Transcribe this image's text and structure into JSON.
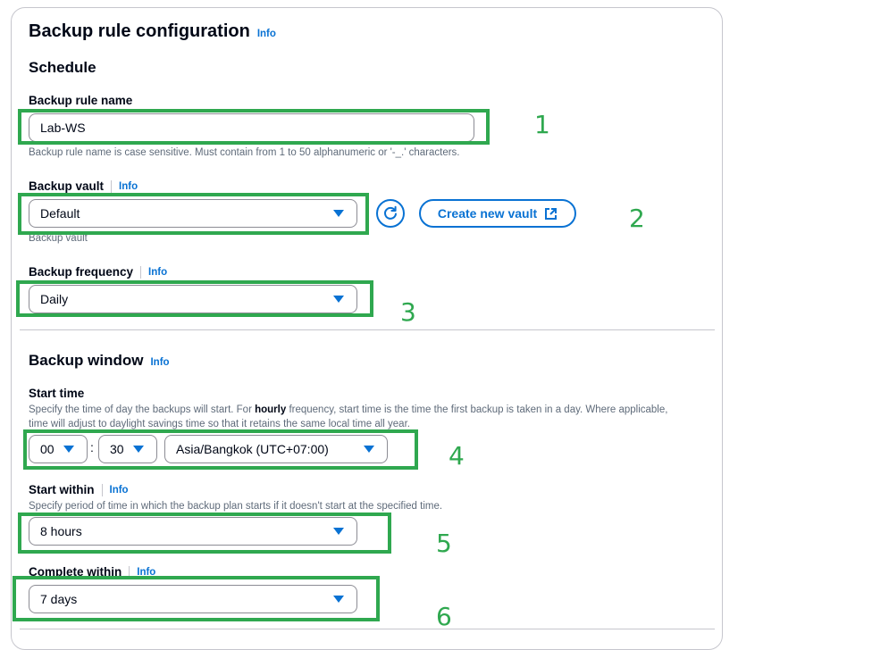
{
  "header": {
    "title": "Backup rule configuration",
    "info": "Info"
  },
  "schedule": {
    "title": "Schedule"
  },
  "rule_name": {
    "label": "Backup rule name",
    "value": "Lab-WS",
    "hint": "Backup rule name is case sensitive. Must contain from 1 to 50 alphanumeric or '-_.' characters."
  },
  "vault": {
    "label": "Backup vault",
    "info": "Info",
    "selected": "Default",
    "hint": "Backup vault",
    "create_label": "Create new vault"
  },
  "frequency": {
    "label": "Backup frequency",
    "info": "Info",
    "selected": "Daily"
  },
  "window": {
    "title": "Backup window",
    "info": "Info",
    "start_time": {
      "label": "Start time",
      "hint_before": "Specify the time of day the backups will start. For ",
      "hint_bold": "hourly",
      "hint_after": " frequency, start time is the time the first backup is taken in a day. Where applicable, time will adjust to daylight savings time so that it retains the same local time all year.",
      "hour": "00",
      "colon": ":",
      "minute": "30",
      "timezone": "Asia/Bangkok (UTC+07:00)"
    },
    "start_within": {
      "label": "Start within",
      "info": "Info",
      "hint": "Specify period of time in which the backup plan starts if it doesn't start at the specified time.",
      "selected": "8 hours"
    },
    "complete_within": {
      "label": "Complete within",
      "info": "Info",
      "selected": "7 days"
    }
  },
  "annotations": [
    "1",
    "2",
    "3",
    "4",
    "5",
    "6"
  ],
  "colors": {
    "accent": "#0972d3",
    "highlight": "#2fa84f",
    "text": "#000716",
    "muted": "#5f6b7a"
  }
}
